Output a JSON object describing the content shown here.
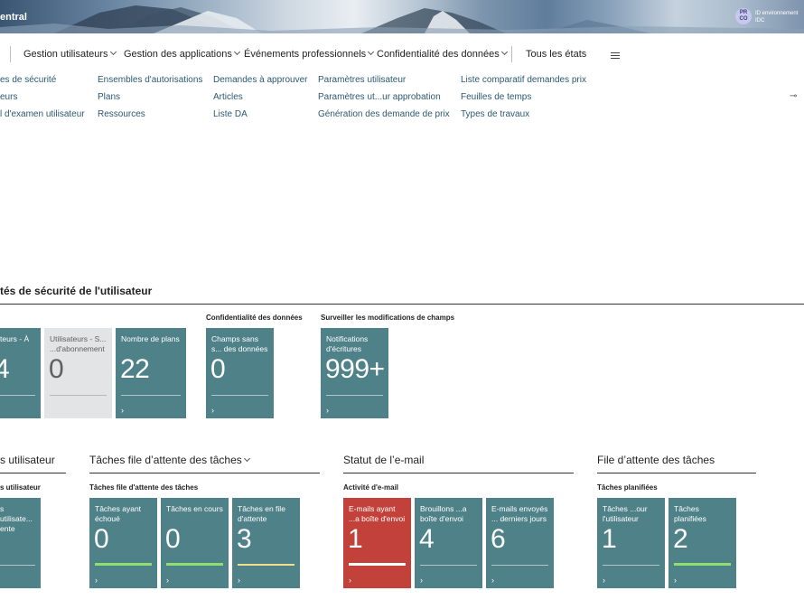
{
  "header": {
    "app_title": "entral",
    "avatar_initials_line1": "PR",
    "avatar_initials_line2": "CO",
    "environment_line1": "ID environnement",
    "environment_line2": "IDC"
  },
  "nav": {
    "items": [
      {
        "label": "Gestion utilisateurs"
      },
      {
        "label": "Gestion des applications"
      },
      {
        "label": "Événements professionnels"
      },
      {
        "label": "Confidentialité des données"
      }
    ],
    "all_states": "Tous les états"
  },
  "links": {
    "col1": [
      "es de sécurité",
      "eurs",
      "l d'examen utilisateur"
    ],
    "col2": [
      "Ensembles d'autorisations",
      "Plans",
      "Ressources"
    ],
    "col3": [
      "Demandes à approuver",
      "Articles",
      "Liste DA"
    ],
    "col4": [
      "Paramètres utilisateur",
      "Paramètres ut...ur approbation",
      "Génération des demande de prix"
    ],
    "col5": [
      "Liste comparatif demandes prix",
      "Feuilles de temps",
      "Types de travaux"
    ]
  },
  "security_section": {
    "title": "tés de sécurité de l'utilisateur",
    "data_privacy_label": "Confidentialité des données",
    "field_monitor_label": "Surveiller les modifications de champs",
    "tiles": [
      {
        "label": "teurs - À",
        "value": "4"
      },
      {
        "label": "Utilisateurs - S... ...d'abonnement",
        "value": "0"
      },
      {
        "label": "Nombre de plans",
        "value": "22"
      },
      {
        "label": "Champs sans s... des données",
        "value": "0"
      },
      {
        "label": "Notifications d'écritures",
        "value": "999+"
      }
    ]
  },
  "bottom": {
    "users": {
      "title": "s utilisateur",
      "group": "s utilisateur",
      "tile": {
        "label": "s utilisate... ente",
        "value": ""
      }
    },
    "job_queue_tasks": {
      "title": "Tâches file d’attente des tâches",
      "group": "Tâches file d'attente des tâches",
      "tiles": [
        {
          "label": "Tâches ayant échoué",
          "value": "0"
        },
        {
          "label": "Tâches en cours",
          "value": "0"
        },
        {
          "label": "Tâches en file d'attente",
          "value": "3"
        }
      ]
    },
    "email_status": {
      "title": "Statut de l’e-mail",
      "group": "Activité d'e-mail",
      "tiles": [
        {
          "label": "E-mails ayant ...a boîte d'envoi",
          "value": "1"
        },
        {
          "label": "Brouillons ...a boîte d'envoi",
          "value": "4"
        },
        {
          "label": "E-mails envoyés ... derniers jours",
          "value": "6"
        }
      ]
    },
    "job_queue": {
      "title": "File d’attente des tâches",
      "group": "Tâches planifiées",
      "tiles": [
        {
          "label": "Tâches ...our l'utilisateur",
          "value": "1"
        },
        {
          "label": "Tâches planifiées",
          "value": "2"
        }
      ]
    },
    "arrow": "›"
  }
}
